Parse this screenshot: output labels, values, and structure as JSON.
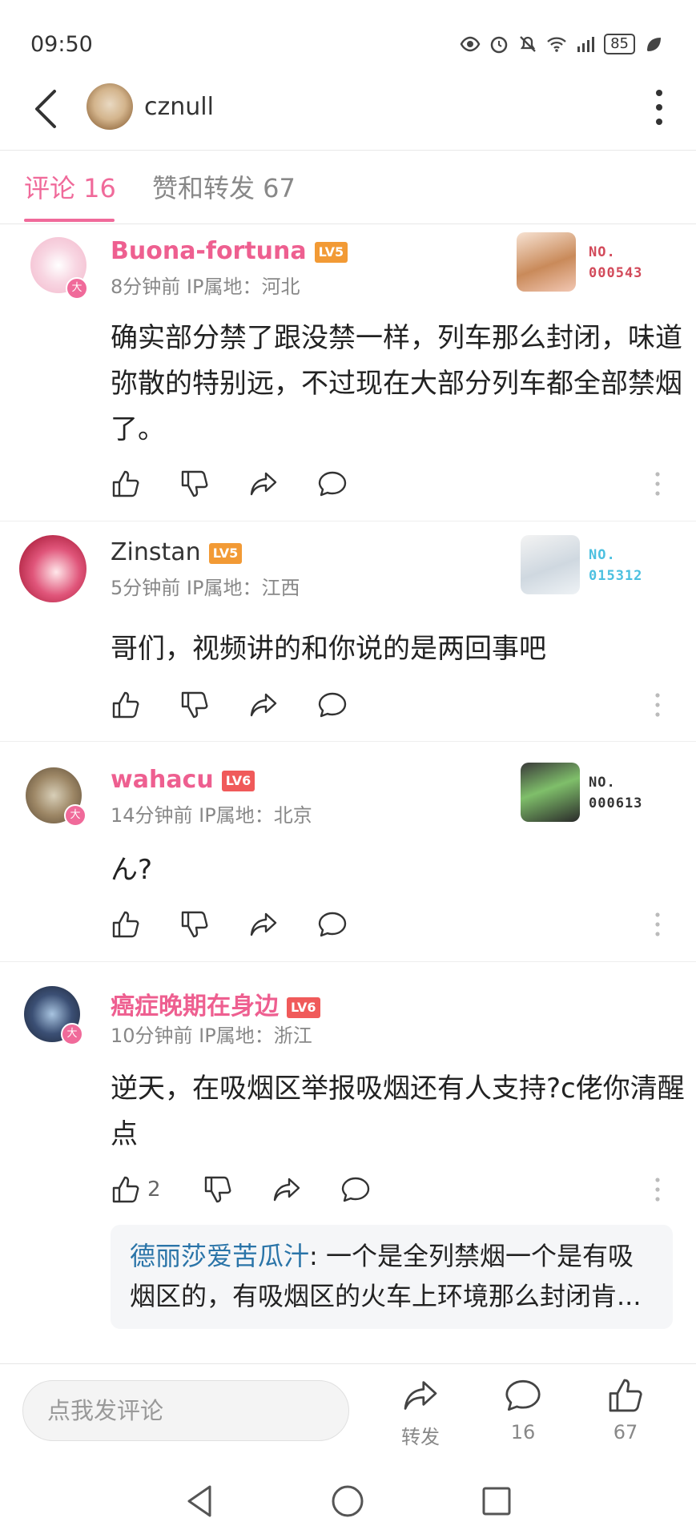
{
  "status_bar": {
    "time": "09:50",
    "battery": "85"
  },
  "header": {
    "username": "cznull"
  },
  "tabs": [
    {
      "label": "评论 16",
      "active": true
    },
    {
      "label": "赞和转发 67",
      "active": false
    }
  ],
  "comments": [
    {
      "name": "Buona-fortuna",
      "level": "LV5",
      "vip_label": "大",
      "meta": "8分钟前  IP属地：河北",
      "text": "确实部分禁了跟没禁一样，列车那么封闭，味道弥散的特别远，不过现在大部分列车都全部禁烟了。",
      "badge_no_label": "NO.",
      "badge_number": "000543",
      "badge_color": "#d24a5a",
      "likes": ""
    },
    {
      "name": "Zinstan",
      "level": "LV5",
      "vip_label": "",
      "meta": "5分钟前  IP属地：江西",
      "text": "哥们，视频讲的和你说的是两回事吧",
      "badge_no_label": "NO.",
      "badge_number": "015312",
      "badge_color": "#4cc0e0",
      "likes": ""
    },
    {
      "name": "wahacu",
      "level": "LV6",
      "vip_label": "大",
      "meta": "14分钟前  IP属地：北京",
      "text": "ん?",
      "badge_no_label": "NO.",
      "badge_number": "000613",
      "badge_color": "#333333",
      "likes": ""
    },
    {
      "name": "癌症晚期在身边",
      "level": "LV6",
      "vip_label": "大",
      "meta": "10分钟前  IP属地：浙江",
      "text": "逆天，在吸烟区举报吸烟还有人支持?c佬你清醒点",
      "likes": "2",
      "reply": {
        "name": "德丽莎爱苦瓜汁",
        "text": ": 一个是全列禁烟一个是有吸烟区的，有吸烟区的火车上环境那么封闭肯..."
      }
    }
  ],
  "bottom_bar": {
    "input_placeholder": "点我发评论",
    "share_label": "转发",
    "comment_count": "16",
    "like_count": "67"
  },
  "colors": {
    "accent": "#f06a9a",
    "reply_name": "#2a74a8"
  },
  "icons": [
    "eye-icon",
    "alarm-icon",
    "mute-icon",
    "wifi-icon",
    "signal-icon",
    "leaf-icon",
    "back-icon",
    "more-vertical-icon",
    "thumb-up-icon",
    "thumb-down-icon",
    "share-icon",
    "comment-icon",
    "nav-back-icon",
    "nav-home-icon",
    "nav-recents-icon"
  ]
}
